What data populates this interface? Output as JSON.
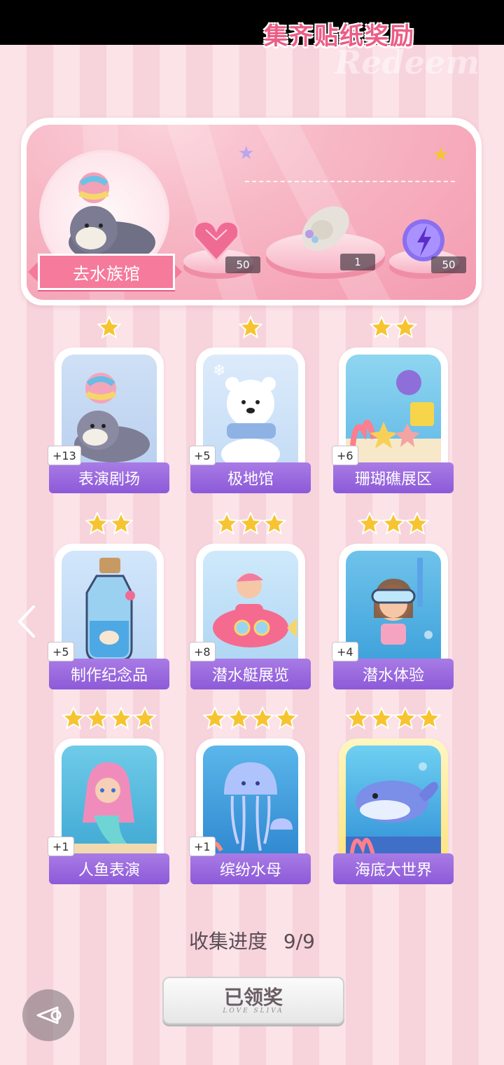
{
  "panel": {
    "title": "集齐贴纸奖励",
    "watermark": "Redeem",
    "aquarium_button": "去水族馆",
    "rewards": [
      {
        "icon": "pink-heart-gem-icon",
        "count": "50"
      },
      {
        "icon": "sun-hat-icon",
        "count": "1"
      },
      {
        "icon": "purple-lightning-orb-icon",
        "count": "50"
      }
    ]
  },
  "cards": [
    {
      "label": "表演剧场",
      "count": "+13",
      "stars": 1,
      "art": "seal-with-ball"
    },
    {
      "label": "极地馆",
      "count": "+5",
      "stars": 1,
      "art": "polar-bear"
    },
    {
      "label": "珊瑚礁展区",
      "count": "+6",
      "stars": 2,
      "art": "coral-reef"
    },
    {
      "label": "制作纪念品",
      "count": "+5",
      "stars": 2,
      "art": "message-bottle"
    },
    {
      "label": "潜水艇展览",
      "count": "+8",
      "stars": 3,
      "art": "submarine"
    },
    {
      "label": "潜水体验",
      "count": "+4",
      "stars": 3,
      "art": "diver-girl"
    },
    {
      "label": "人鱼表演",
      "count": "+1",
      "stars": 4,
      "art": "mermaid"
    },
    {
      "label": "缤纷水母",
      "count": "+1",
      "stars": 4,
      "art": "jellyfish"
    },
    {
      "label": "海底大世界",
      "count": "",
      "stars": 4,
      "art": "whale"
    }
  ],
  "progress": {
    "label": "收集进度",
    "value": "9/9"
  },
  "claim_button": {
    "label": "已领奖",
    "sub": "LOVE SLIVA"
  },
  "colors": {
    "accent_pink": "#ec5d86",
    "label_purple": "#8c5ad8",
    "star_gold": "#f7c431"
  }
}
